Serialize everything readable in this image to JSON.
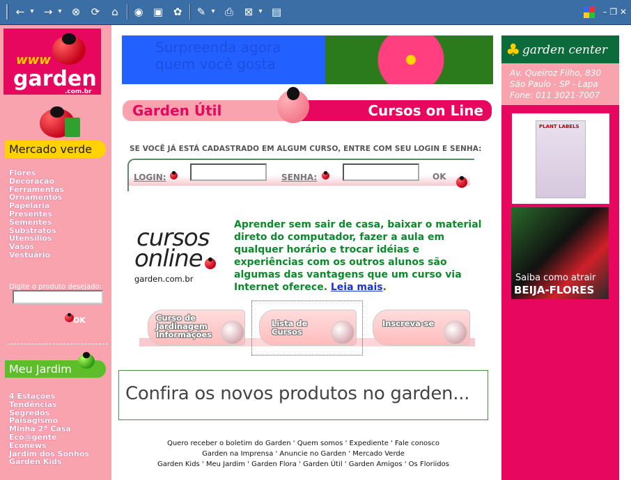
{
  "toolbar": {
    "buttons": [
      "←",
      "▾",
      "→",
      "▾",
      "⊗",
      "⟳",
      "⌂",
      "◉",
      "▣",
      "✿",
      "✎",
      "▾",
      "⎙",
      "⊠",
      "▾",
      "▤"
    ],
    "window_controls": "– ❐ ✕"
  },
  "left": {
    "logo": {
      "www": "www",
      "name": "garden",
      "domain": ".com.br"
    },
    "mercado_verde": "Mercado verde",
    "links": [
      "Flores",
      "Decoração",
      "Ferramentas",
      "Ornamentos",
      "Papelaria",
      "Presentes",
      "Sementes",
      "Substratos",
      "Utensílios",
      "Vasos",
      "Vestuário"
    ],
    "product_label": "Digite o produto desejado:",
    "ok": "OK",
    "meu_jardim": "Meu Jardim",
    "links2": [
      "4 Estações",
      "Tendências",
      "Segredos",
      "Paisagismo",
      "Minha 2ª Casa",
      "Eco@gente",
      "Econews",
      "Jardim dos Sonhos",
      "Garden Kids"
    ]
  },
  "banner": {
    "line1": "Surpreenda agora",
    "line2": "quem você gosta"
  },
  "header": {
    "left": "Garden Útil",
    "right": "Cursos on Line"
  },
  "login": {
    "instruction": "SE VOCÊ JÁ ESTÁ CADASTRADO EM ALGUM CURSO, ENTRE COM SEU LOGIN E SENHA:",
    "login_label": "LOGIN:",
    "senha_label": "SENHA:",
    "ok": "OK"
  },
  "cursos_logo": {
    "line1": "cursos",
    "line2": "online",
    "domain": "garden.com.br"
  },
  "description": {
    "text": "Aprender sem sair de casa, baixar o material direto do computador, fazer a aula em qualquer horário e trocar idéias e experiências com os outros alunos são algumas das vantagens que um curso via Internet oferece.",
    "link": "Leia mais",
    "after": "."
  },
  "course_buttons": [
    {
      "line1": "Curso de",
      "line2": "Jardinagem",
      "line3": "Informações"
    },
    {
      "line1": "Lista de",
      "line2": "Cursos",
      "line3": ""
    },
    {
      "line1": "Inscreva-se",
      "line2": "",
      "line3": ""
    }
  ],
  "confira": "Confira os novos produtos no garden...",
  "footer": {
    "line1": "Quero receber o boletim do Garden ' Quem somos ' Expediente ' Fale conosco",
    "line2": "Garden na Imprensa ' Anuncie no Garden ' Mercado Verde",
    "line3": "Garden Kids ' Meu Jardim ' Garden Flora ' Garden Útil ' Garden Amigos ' Os Floriidos"
  },
  "right": {
    "garden_center": "garden center",
    "address": [
      "Av. Queiroz Filho, 830",
      "São Paulo - SP - Lapa",
      "Fone: 011 3021-7007"
    ],
    "plant_labels": "PLANT LABELS",
    "bird_line1": "Saiba como atrair",
    "bird_line2": "BEIJA-FLORES"
  },
  "colors": {
    "magenta": "#e8075f",
    "pink": "#f8a3ad",
    "green_text": "#0a8a2a",
    "yellow": "#ffd200"
  }
}
